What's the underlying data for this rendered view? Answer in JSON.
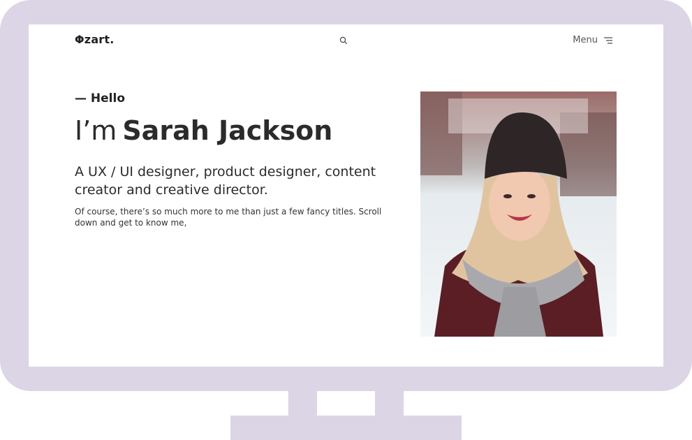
{
  "brand": {
    "logo_text": "Φzart."
  },
  "nav": {
    "menu_label": "Menu",
    "search_icon": "search-icon",
    "menu_icon": "menu-lines-icon"
  },
  "hero": {
    "greeting": "— Hello",
    "title_prefix": "I’m",
    "name": "Sarah Jackson",
    "lead": "A UX / UI designer, product designer, content creator and creative director.",
    "body": "Of course, there’s so much more to me than just a few fancy titles. Scroll down and get to know me,"
  },
  "colors": {
    "frame": "#dbd5e6",
    "screen_bg": "#ffffff",
    "text": "#2b2b2b"
  }
}
